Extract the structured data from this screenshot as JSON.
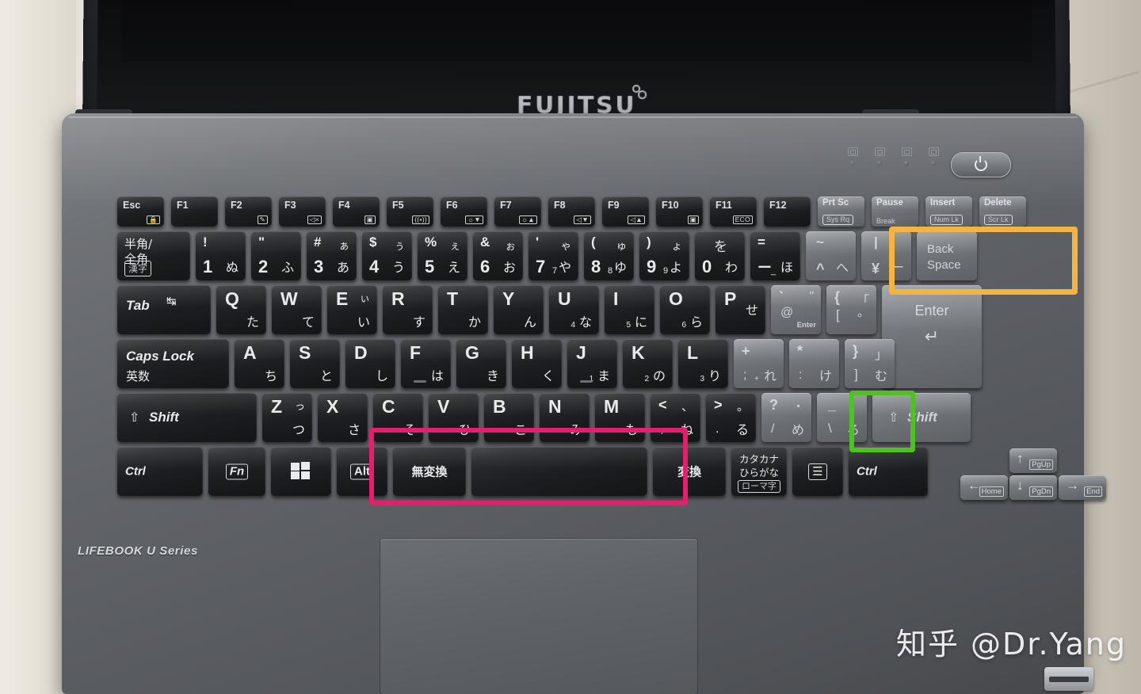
{
  "device": {
    "lid_brand": "FUJITSU",
    "base_brand": "LIFEBOOK  U Series",
    "watermark": "知乎 @Dr.Yang"
  },
  "highlights": {
    "orange": {
      "color": "#f2b542",
      "keys": [
        "^ へ",
        "¥ | ー",
        "Back Space"
      ]
    },
    "green": {
      "color": "#4fc122",
      "keys": [
        "\\ _ ろ"
      ]
    },
    "pink": {
      "color": "#e61e6e",
      "keys": [
        "無変換",
        "Space",
        "変換"
      ]
    }
  },
  "keyboard": {
    "function_row": [
      {
        "label": "Esc",
        "glyph": "lock-icon",
        "glyph_text": "⌂"
      },
      {
        "label": "F1",
        "glyph": "",
        "glyph_text": ""
      },
      {
        "label": "F2",
        "glyph": "pen-icon",
        "glyph_text": "✎"
      },
      {
        "label": "F3",
        "glyph": "mute-icon",
        "glyph_text": "◁x"
      },
      {
        "label": "F4",
        "glyph": "webcam-icon",
        "glyph_text": "▣"
      },
      {
        "label": "F5",
        "glyph": "wireless-icon",
        "glyph_text": "((●))"
      },
      {
        "label": "F6",
        "glyph": "brightness-down-icon",
        "glyph_text": "☼▼"
      },
      {
        "label": "F7",
        "glyph": "brightness-up-icon",
        "glyph_text": "☼▲"
      },
      {
        "label": "F8",
        "glyph": "volume-down-icon",
        "glyph_text": "◁▼"
      },
      {
        "label": "F9",
        "glyph": "volume-up-icon",
        "glyph_text": "◁▲"
      },
      {
        "label": "F10",
        "glyph": "display-icon",
        "glyph_text": "▣"
      },
      {
        "label": "F11",
        "glyph": "eco-icon",
        "glyph_text": "ECO"
      },
      {
        "label": "F12",
        "glyph": "",
        "glyph_text": ""
      },
      {
        "label": "Prt Sc",
        "sub": "Sys Rq"
      },
      {
        "label": "Pause",
        "sub": "Break"
      },
      {
        "label": "Insert",
        "sub": "Num Lk"
      },
      {
        "label": "Delete",
        "sub": "Scr Lk"
      }
    ],
    "number_row": [
      {
        "name": "hankaku-zenkaku",
        "line1": "半角/",
        "line2": "全角",
        "line3": "漢字"
      },
      {
        "tl": "!",
        "bl": "1",
        "br": "ぬ"
      },
      {
        "tl": "\"",
        "bl": "2",
        "br": "ふ"
      },
      {
        "tl": "#",
        "tr": "ぁ",
        "bl": "3",
        "br": "あ"
      },
      {
        "tl": "$",
        "tr": "ぅ",
        "bl": "4",
        "br": "う"
      },
      {
        "tl": "%",
        "tr": "ぇ",
        "bl": "5",
        "br": "え"
      },
      {
        "tl": "&",
        "tr": "ぉ",
        "bl": "6",
        "br": "お"
      },
      {
        "tl": "'",
        "tr": "ゃ",
        "bl": "7",
        "blsub": "7",
        "br": "や"
      },
      {
        "tl": "(",
        "tr": "ゅ",
        "bl": "8",
        "blsub": "8",
        "br": "ゆ"
      },
      {
        "tl": ")",
        "tr": "ょ",
        "bl": "9",
        "blsub": "9",
        "br": "よ"
      },
      {
        "tr": "を",
        "bl": "0",
        "br": "わ"
      },
      {
        "tl": "=",
        "bl": "ー",
        "blsub": "_",
        "br": "ほ"
      },
      {
        "tl": "~",
        "bl": "^",
        "br": "へ"
      },
      {
        "tl": "|",
        "bl": "¥",
        "br": "ー"
      },
      {
        "name": "backspace",
        "line1": "Back",
        "line2": "Space"
      }
    ],
    "q_row": [
      {
        "name": "tab",
        "label": "Tab",
        "glyph": "tab-arrows-icon"
      },
      {
        "big": "Q",
        "kana": "た"
      },
      {
        "big": "W",
        "kana": "て"
      },
      {
        "big": "E",
        "kana": "い",
        "kana2": "ぃ"
      },
      {
        "big": "R",
        "kana": "す"
      },
      {
        "big": "T",
        "kana": "か"
      },
      {
        "big": "Y",
        "kana": "ん"
      },
      {
        "big": "U",
        "kana": "な",
        "num": "4"
      },
      {
        "big": "I",
        "kana": "に",
        "num": "5"
      },
      {
        "big": "O",
        "kana": "ら",
        "num": "6"
      },
      {
        "big": "P",
        "kana": "せ"
      },
      {
        "tl": "`",
        "tlsub": "@",
        "kana2": "\"",
        "sub2": "Enter"
      },
      {
        "tl": "{",
        "tlsub": "[",
        "kana2": "「",
        "kana": "。"
      },
      {
        "name": "enter",
        "label": "Enter",
        "glyph": "enter-arrow-icon"
      }
    ],
    "a_row": [
      {
        "name": "caps-lock",
        "label": "Caps Lock",
        "sub": "英数"
      },
      {
        "big": "A",
        "kana": "ち"
      },
      {
        "big": "S",
        "kana": "と"
      },
      {
        "big": "D",
        "kana": "し"
      },
      {
        "big": "F",
        "kana": "は"
      },
      {
        "big": "G",
        "kana": "き"
      },
      {
        "big": "H",
        "kana": "く"
      },
      {
        "big": "J",
        "kana": "ま",
        "num": "1"
      },
      {
        "big": "K",
        "kana": "の",
        "num": "2"
      },
      {
        "big": "L",
        "kana": "り",
        "num": "3"
      },
      {
        "tl": "+",
        "tlsub": ";",
        "tlsub2": "+",
        "kana": "れ"
      },
      {
        "tl": "*",
        "tlsub": ":",
        "tlsub2": "*",
        "kana": "け"
      },
      {
        "tl": "}",
        "tlsub": "]",
        "kana2": "」",
        "kana": "む"
      }
    ],
    "z_row": [
      {
        "name": "shift-left",
        "label": "Shift",
        "glyph": "shift-arrow-icon"
      },
      {
        "big": "Z",
        "kana": "つ",
        "kana2": "っ"
      },
      {
        "big": "X",
        "kana": "さ"
      },
      {
        "big": "C",
        "kana": "そ"
      },
      {
        "big": "V",
        "kana": "ひ"
      },
      {
        "big": "B",
        "kana": "こ"
      },
      {
        "big": "N",
        "kana": "み"
      },
      {
        "big": "M",
        "kana": "も"
      },
      {
        "tl": "<",
        "tlsub": ",",
        "kana2": "、",
        "kana": "ね"
      },
      {
        "tl": ">",
        "tlsub": ".",
        "kana2": "。",
        "kana": "る"
      },
      {
        "tl": "?",
        "tlsub": "/",
        "kana2": "・",
        "kana": "め"
      },
      {
        "tl": "_",
        "tlsub": "\\",
        "kana": "ろ"
      },
      {
        "name": "shift-right",
        "label": "Shift",
        "glyph": "shift-arrow-icon"
      }
    ],
    "space_row": [
      {
        "name": "ctrl-left",
        "label": "Ctrl"
      },
      {
        "name": "fn",
        "label": "Fn"
      },
      {
        "name": "windows",
        "label": "",
        "glyph": "windows-icon"
      },
      {
        "name": "alt-left",
        "label": "Alt"
      },
      {
        "name": "muhenkan",
        "label": "無変換"
      },
      {
        "name": "space",
        "label": ""
      },
      {
        "name": "henkan",
        "label": "変換"
      },
      {
        "name": "katakana-hiragana",
        "line1": "カタカナ",
        "line2": "ひらがな",
        "line3": "ローマ字"
      },
      {
        "name": "context-menu",
        "label": "",
        "glyph": "menu-icon"
      },
      {
        "name": "ctrl-right",
        "label": "Ctrl"
      }
    ],
    "arrow_cluster": [
      {
        "name": "arrow-up",
        "arrow": "↑",
        "tag": "PgUp"
      },
      {
        "name": "arrow-left",
        "arrow": "←",
        "tag": "Home"
      },
      {
        "name": "arrow-down",
        "arrow": "↓",
        "tag": "PgDn"
      },
      {
        "name": "arrow-right",
        "arrow": "→",
        "tag": "End"
      }
    ]
  },
  "indicators": {
    "count": 4,
    "power_button": "power-icon"
  }
}
